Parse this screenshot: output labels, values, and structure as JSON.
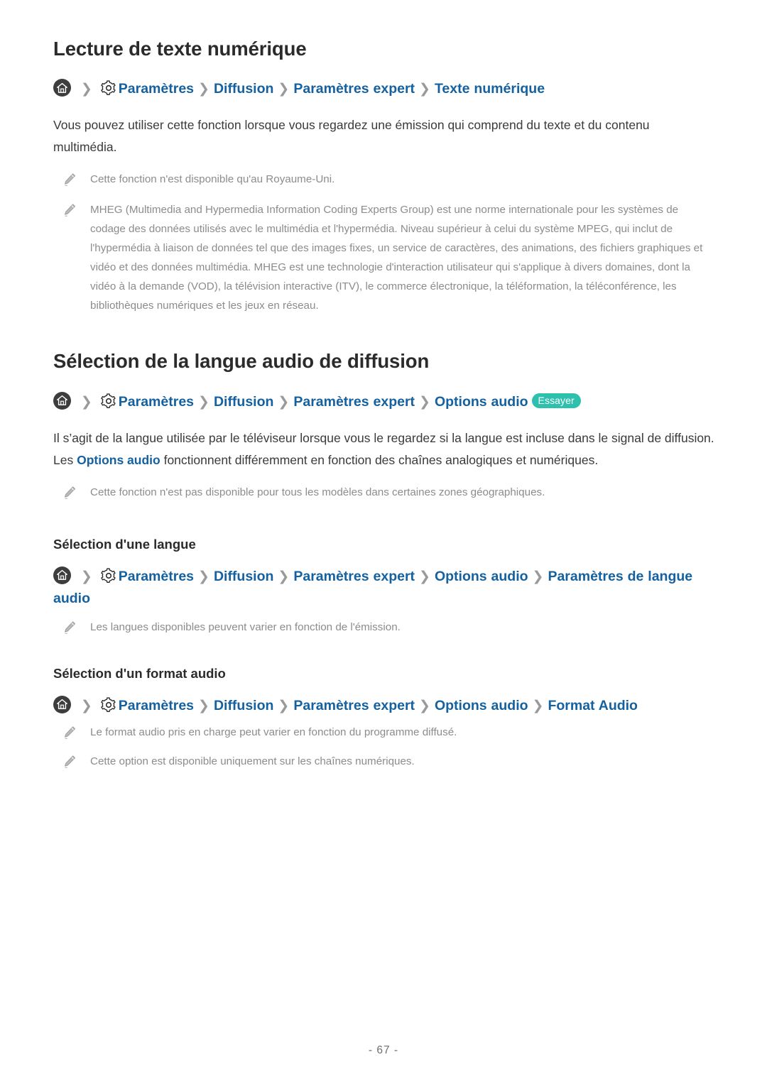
{
  "document": {
    "page_number": "- 67 -",
    "accent_link_color": "#15619f",
    "badge_color": "#2cc0ad",
    "note_text_color": "#8c8c8c",
    "body_text_color": "#3a3a3a"
  },
  "section_digital_text": {
    "title": "Lecture de texte numérique",
    "breadcrumb": {
      "home_icon": "home-icon",
      "gear_icon": "gear-icon",
      "separator": "❯",
      "items": [
        "Paramètres",
        "Diffusion",
        "Paramètres expert",
        "Texte numérique"
      ]
    },
    "body": "Vous pouvez utiliser cette fonction lorsque vous regardez une émission qui comprend du texte et du contenu multimédia.",
    "notes": [
      "Cette fonction n'est disponible qu'au Royaume-Uni.",
      "MHEG (Multimedia and Hypermedia Information Coding Experts Group) est une norme internationale pour les systèmes de codage des données utilisés avec le multimédia et l'hypermédia. Niveau supérieur à celui du système MPEG, qui inclut de l'hypermédia à liaison de données tel que des images fixes, un service de caractères, des animations, des fichiers graphiques et vidéo et des données multimédia. MHEG est une technologie d'interaction utilisateur qui s'applique à divers domaines, dont la vidéo à la demande (VOD), la télévision interactive (ITV), le commerce électronique, la téléformation, la téléconférence, les bibliothèques numériques et les jeux en réseau."
    ]
  },
  "section_audio_language": {
    "title": "Sélection de la langue audio de diffusion",
    "breadcrumb": {
      "home_icon": "home-icon",
      "gear_icon": "gear-icon",
      "separator": "❯",
      "items": [
        "Paramètres",
        "Diffusion",
        "Paramètres expert",
        "Options audio"
      ],
      "badge": "Essayer"
    },
    "body_part_1": "Il s’agit de la langue utilisée par le téléviseur lorsque vous le regardez si la langue est incluse dans le signal de diffusion. Les ",
    "body_link": "Options audio",
    "body_part_2": " fonctionnent différemment en fonction des chaînes analogiques et numériques.",
    "notes": [
      "Cette fonction n'est pas disponible pour tous les modèles dans certaines zones géographiques."
    ]
  },
  "subsection_language_selection": {
    "title": "Sélection d'une langue",
    "breadcrumb": {
      "home_icon": "home-icon",
      "gear_icon": "gear-icon",
      "separator": "❯",
      "items": [
        "Paramètres",
        "Diffusion",
        "Paramètres expert",
        "Options audio",
        "Paramètres de langue audio"
      ]
    },
    "notes": [
      "Les langues disponibles peuvent varier en fonction de l'émission."
    ]
  },
  "subsection_audio_format": {
    "title": "Sélection d'un format audio",
    "breadcrumb": {
      "home_icon": "home-icon",
      "gear_icon": "gear-icon",
      "separator": "❯",
      "items": [
        "Paramètres",
        "Diffusion",
        "Paramètres expert",
        "Options audio",
        "Format Audio"
      ]
    },
    "notes": [
      "Le format audio pris en charge peut varier en fonction du programme diffusé.",
      "Cette option est disponible uniquement sur les chaînes numériques."
    ]
  }
}
